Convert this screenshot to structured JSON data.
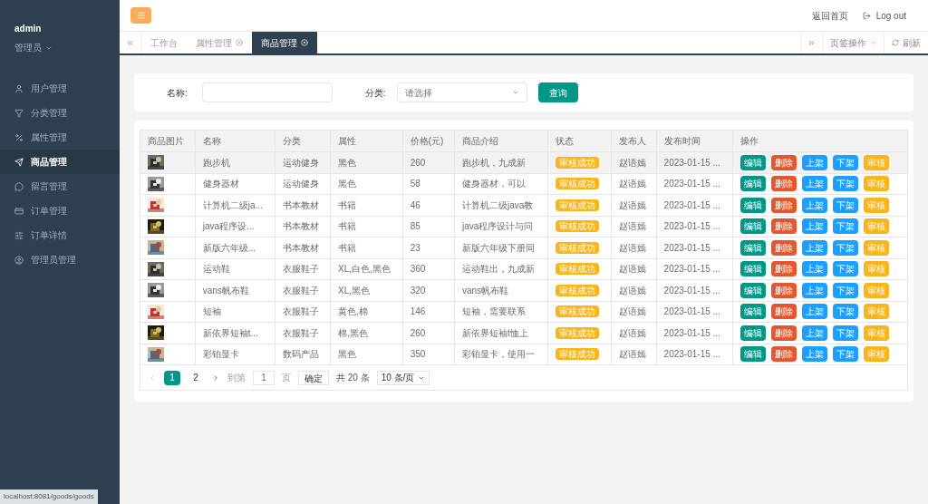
{
  "user": {
    "name": "admin",
    "role": "管理员"
  },
  "sidebar": {
    "items": [
      {
        "label": "用户管理",
        "selected": false
      },
      {
        "label": "分类管理",
        "selected": false
      },
      {
        "label": "属性管理",
        "selected": false
      },
      {
        "label": "商品管理",
        "selected": true
      },
      {
        "label": "留言管理",
        "selected": false
      },
      {
        "label": "订单管理",
        "selected": false
      },
      {
        "label": "订单详情",
        "selected": false
      },
      {
        "label": "管理员管理",
        "selected": false
      }
    ]
  },
  "header": {
    "links": [
      {
        "label": "返回首页",
        "kind": "plain"
      },
      {
        "label": "Log out",
        "kind": "logout"
      }
    ]
  },
  "tabs": [
    {
      "label": "工作台",
      "closable": false,
      "selected": false
    },
    {
      "label": "属性管理",
      "closable": true,
      "selected": false
    },
    {
      "label": "商品管理",
      "closable": true,
      "selected": true
    }
  ],
  "tab_tools": [
    {
      "label": "页签操作",
      "kind": "dropdown"
    },
    {
      "label": "刷新",
      "kind": "refresh"
    }
  ],
  "search": {
    "name_label": "名称:",
    "category_label": "分类:",
    "category_placeholder": "请选择",
    "button": "查询"
  },
  "table": {
    "columns": [
      "商品图片",
      "名称",
      "分类",
      "属性",
      "价格(元)",
      "商品介绍",
      "状态",
      "发布人",
      "发布时间",
      "操作"
    ],
    "rows": [
      {
        "name": "跑步机",
        "category": "运动健身",
        "attr": "黑色",
        "price": "260",
        "intro": "跑步机，九成新",
        "status": "审核成功",
        "publisher": "赵语嫣",
        "time": "2023-01-15 ...",
        "selected": true,
        "actions": [
          {
            "label": "编辑",
            "kind": "edit"
          },
          {
            "label": "删除",
            "kind": "delete"
          },
          {
            "label": "上架",
            "kind": "info"
          },
          {
            "label": "下架",
            "kind": "info"
          },
          {
            "label": "审核",
            "kind": "warn"
          }
        ]
      },
      {
        "name": "健身器材",
        "category": "运动健身",
        "attr": "黑色",
        "price": "58",
        "intro": "健身器材，可以",
        "status": "审核成功",
        "publisher": "赵语嫣",
        "time": "2023-01-15 ...",
        "selected": false,
        "actions": [
          {
            "label": "编辑",
            "kind": "edit"
          },
          {
            "label": "删除",
            "kind": "delete"
          },
          {
            "label": "上架",
            "kind": "info"
          },
          {
            "label": "下架",
            "kind": "info"
          },
          {
            "label": "审核",
            "kind": "warn"
          }
        ]
      },
      {
        "name": "计算机二级ja...",
        "category": "书本教材",
        "attr": "书籍",
        "price": "46",
        "intro": "计算机二级java教",
        "status": "审核成功",
        "publisher": "赵语嫣",
        "time": "2023-01-15 ...",
        "selected": false,
        "actions": [
          {
            "label": "编辑",
            "kind": "edit"
          },
          {
            "label": "删除",
            "kind": "delete"
          },
          {
            "label": "上架",
            "kind": "info"
          },
          {
            "label": "下架",
            "kind": "info"
          },
          {
            "label": "审核",
            "kind": "warn"
          }
        ]
      },
      {
        "name": "java程序设...",
        "category": "书本教材",
        "attr": "书籍",
        "price": "85",
        "intro": "java程序设计与问",
        "status": "审核成功",
        "publisher": "赵语嫣",
        "time": "2023-01-15 ...",
        "selected": false,
        "actions": [
          {
            "label": "编辑",
            "kind": "edit"
          },
          {
            "label": "删除",
            "kind": "delete"
          },
          {
            "label": "上架",
            "kind": "info"
          },
          {
            "label": "下架",
            "kind": "info"
          },
          {
            "label": "审核",
            "kind": "warn"
          }
        ]
      },
      {
        "name": "新版六年级...",
        "category": "书本教材",
        "attr": "书籍",
        "price": "23",
        "intro": "新版六年级下册同",
        "status": "审核成功",
        "publisher": "赵语嫣",
        "time": "2023-01-15 ...",
        "selected": false,
        "actions": [
          {
            "label": "编辑",
            "kind": "edit"
          },
          {
            "label": "删除",
            "kind": "delete"
          },
          {
            "label": "上架",
            "kind": "info"
          },
          {
            "label": "下架",
            "kind": "info"
          },
          {
            "label": "审核",
            "kind": "warn"
          }
        ]
      },
      {
        "name": "运动鞋",
        "category": "衣服鞋子",
        "attr": "XL,白色,黑色",
        "price": "360",
        "intro": "运动鞋出，九成新",
        "status": "审核成功",
        "publisher": "赵语嫣",
        "time": "2023-01-15 ...",
        "selected": false,
        "actions": [
          {
            "label": "编辑",
            "kind": "edit"
          },
          {
            "label": "删除",
            "kind": "delete"
          },
          {
            "label": "上架",
            "kind": "info"
          },
          {
            "label": "下架",
            "kind": "info"
          },
          {
            "label": "审核",
            "kind": "warn"
          }
        ]
      },
      {
        "name": "vans帆布鞋",
        "category": "衣服鞋子",
        "attr": "XL,黑色",
        "price": "320",
        "intro": "vans帆布鞋",
        "status": "审核成功",
        "publisher": "赵语嫣",
        "time": "2023-01-15 ...",
        "selected": false,
        "actions": [
          {
            "label": "编辑",
            "kind": "edit"
          },
          {
            "label": "删除",
            "kind": "delete"
          },
          {
            "label": "上架",
            "kind": "info"
          },
          {
            "label": "下架",
            "kind": "info"
          },
          {
            "label": "审核",
            "kind": "warn"
          }
        ]
      },
      {
        "name": "短袖",
        "category": "衣服鞋子",
        "attr": "黄色,棉",
        "price": "146",
        "intro": "短袖，需要联系",
        "status": "审核成功",
        "publisher": "赵语嫣",
        "time": "2023-01-15 ...",
        "selected": false,
        "actions": [
          {
            "label": "编辑",
            "kind": "edit"
          },
          {
            "label": "删除",
            "kind": "delete"
          },
          {
            "label": "上架",
            "kind": "info"
          },
          {
            "label": "下架",
            "kind": "info"
          },
          {
            "label": "审核",
            "kind": "warn"
          }
        ]
      },
      {
        "name": "新依界短袖t...",
        "category": "衣服鞋子",
        "attr": "棉,黑色",
        "price": "260",
        "intro": "新依界短袖t恤上",
        "status": "审核成功",
        "publisher": "赵语嫣",
        "time": "2023-01-15 ...",
        "selected": false,
        "actions": [
          {
            "label": "编辑",
            "kind": "edit"
          },
          {
            "label": "删除",
            "kind": "delete"
          },
          {
            "label": "上架",
            "kind": "info"
          },
          {
            "label": "下架",
            "kind": "info"
          },
          {
            "label": "审核",
            "kind": "warn"
          }
        ]
      },
      {
        "name": "彩铂显卡",
        "category": "数码产品",
        "attr": "黑色",
        "price": "350",
        "intro": "彩铂显卡，使用一",
        "status": "审核成功",
        "publisher": "赵语嫣",
        "time": "2023-01-15 ...",
        "selected": false,
        "actions": [
          {
            "label": "编辑",
            "kind": "edit"
          },
          {
            "label": "删除",
            "kind": "delete"
          },
          {
            "label": "上架",
            "kind": "info"
          },
          {
            "label": "下架",
            "kind": "info"
          },
          {
            "label": "审核",
            "kind": "warn"
          }
        ]
      }
    ]
  },
  "pagination": {
    "pages": [
      {
        "label": "1",
        "selected": true
      },
      {
        "label": "2",
        "selected": false
      }
    ],
    "goto_label": "到第",
    "goto_value": "1",
    "page_unit": "页",
    "confirm": "确定",
    "total": "共 20 条",
    "page_size": "10 条/页"
  },
  "status_bar": "localhost:8081/goods/goods"
}
